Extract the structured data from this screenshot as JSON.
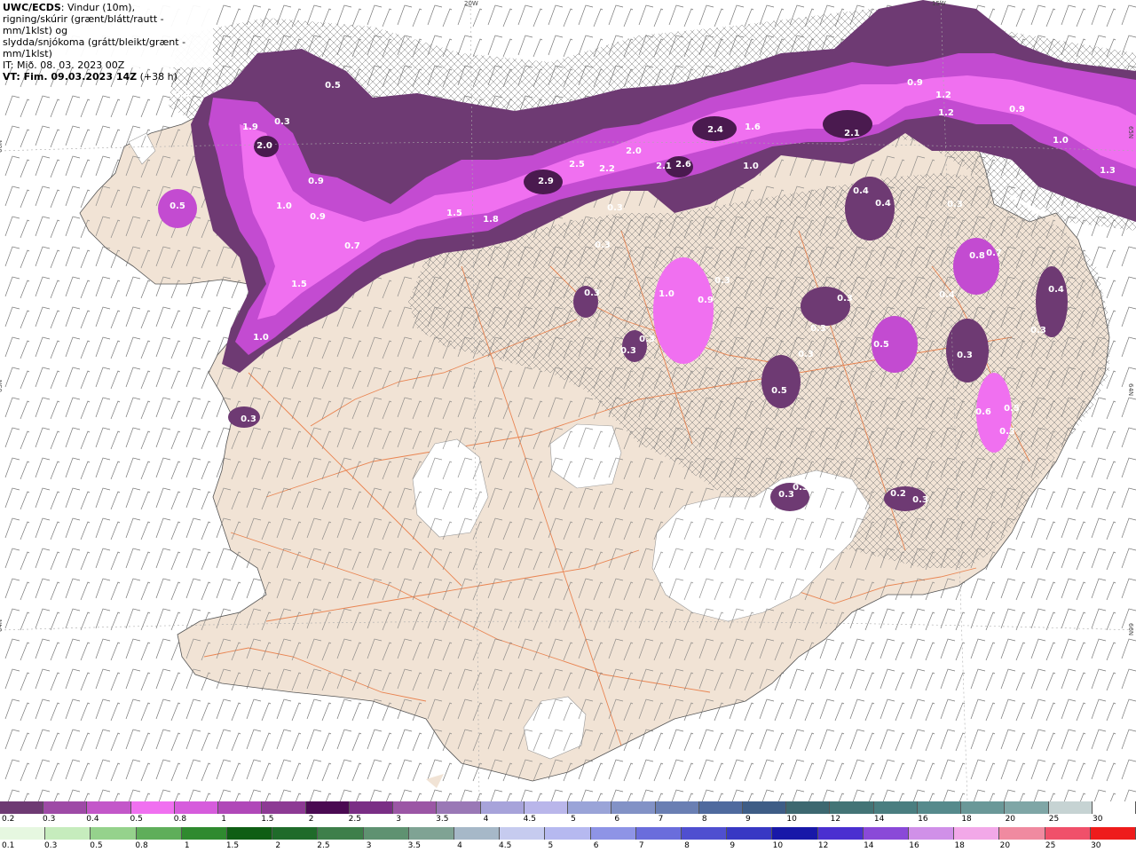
{
  "header": {
    "model": "UWC/ECDS",
    "line1_rest": ": Vindur (10m),",
    "line2": "rigning/skúrir (grænt/blátt/rautt - mm/1klst) og",
    "line3": "slydda/snjókoma (grátt/bleikt/grænt - mm/1klst)",
    "line4": "IT: Mið. 08. 03. 2023 00Z",
    "line5_bold": "VT: Fim. 09.03.2023 14Z",
    "line5_rest": " (+38 h)"
  },
  "map": {
    "colors": {
      "sea": "#ffffff",
      "land": "#f1e3d5",
      "roads": "#e8743b",
      "glacier": "#ffffff",
      "snow_light": "#6e3a73",
      "snow_mid": "#c34bd1",
      "snow_heavy": "#f070f0",
      "snow_core": "#4a1a4f"
    },
    "graticule_labels": [
      "20W",
      "15W",
      "66N",
      "65N",
      "64N",
      "66N",
      "65N",
      "64N"
    ],
    "value_labels": [
      "0.3",
      "0.5",
      "1.9",
      "2.0",
      "0.3",
      "0.5",
      "0.9",
      "1.0",
      "0.9",
      "0.7",
      "1.5",
      "1.0",
      "1.5",
      "1.8",
      "2.9",
      "2.5",
      "2.2",
      "0.3",
      "2.0",
      "2.1",
      "2.6",
      "2.4",
      "1.6",
      "1.0",
      "2.1",
      "0.9",
      "1.2",
      "1.2",
      "0.9",
      "1.0",
      "1.3",
      "0.4",
      "0.4",
      "0.3",
      "0.3",
      "0.3",
      "1.0",
      "0.9",
      "0.3",
      "0.3",
      "0.3",
      "0.3",
      "0.3",
      "0.5",
      "0.5",
      "0.3",
      "0.4",
      "0.8",
      "0.7",
      "0.4",
      "0.3",
      "0.3",
      "0.6",
      "0.5",
      "0.3",
      "0.3",
      "0.3",
      "0.3",
      "0.2",
      "0.3"
    ]
  },
  "legend": {
    "snow_scale": {
      "labels": [
        "0.2",
        "0.3",
        "0.4",
        "0.5",
        "0.8",
        "1",
        "1.5",
        "2",
        "2.5",
        "3",
        "3.5",
        "4",
        "4.5",
        "5",
        "6",
        "7",
        "8",
        "9",
        "10",
        "12",
        "14",
        "16",
        "18",
        "20",
        "25",
        "30"
      ],
      "colors": [
        "#6e3a73",
        "#9e4aa6",
        "#c357c9",
        "#f070f0",
        "#d65cdc",
        "#b048b8",
        "#8d3a94",
        "#4a0a52",
        "#7a2e85",
        "#9b56a5",
        "#9a78b6",
        "#a7a3da",
        "#b9b6ea",
        "#9aa4d8",
        "#8292c6",
        "#6a7fb3",
        "#4f6a9e",
        "#3e5d86",
        "#3d6870",
        "#437476",
        "#4a7e80",
        "#568a8c",
        "#6a9898",
        "#7fa6a6",
        "#c6d3d3",
        "#ffffff"
      ]
    },
    "rain_scale": {
      "labels": [
        "0.1",
        "0.3",
        "0.5",
        "0.8",
        "1",
        "1.5",
        "2",
        "2.5",
        "3",
        "3.5",
        "4",
        "4.5",
        "5",
        "6",
        "7",
        "8",
        "9",
        "10",
        "12",
        "14",
        "16",
        "18",
        "20",
        "25",
        "30"
      ],
      "colors": [
        "#e6f7e0",
        "#c6ecbd",
        "#95d28c",
        "#5fae5a",
        "#2f8a2f",
        "#0f5e14",
        "#1f6b2a",
        "#3e7f4a",
        "#5f9271",
        "#7fa394",
        "#a6b8c8",
        "#c6cbef",
        "#b6b9f0",
        "#8e94e6",
        "#6a6ddc",
        "#4f4fd0",
        "#3838c4",
        "#1818a8",
        "#4a2fd0",
        "#8a49d8",
        "#d090e8",
        "#f2a8e8",
        "#f08aa0",
        "#f0506a",
        "#ee1c1c"
      ]
    }
  }
}
